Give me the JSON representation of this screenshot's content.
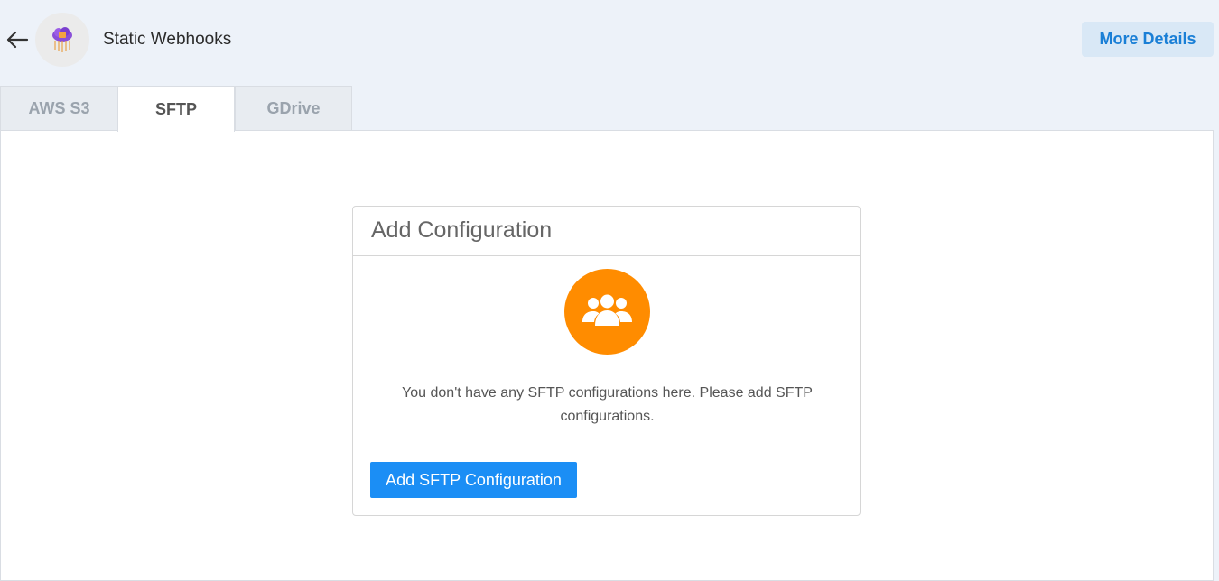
{
  "header": {
    "title": "Static Webhooks",
    "more_details_label": "More Details",
    "back_icon": "arrow-left-icon",
    "logo_icon": "cloud-webhook-logo"
  },
  "tabs": [
    {
      "label": "AWS S3",
      "active": false
    },
    {
      "label": "SFTP",
      "active": true
    },
    {
      "label": "GDrive",
      "active": false
    }
  ],
  "card": {
    "title": "Add Configuration",
    "empty_icon": "users-group-icon",
    "empty_message": "You don't have any SFTP configurations here. Please add SFTP configurations.",
    "add_button_label": "Add SFTP Configuration"
  },
  "colors": {
    "accent_orange": "#ff8c00",
    "primary_blue": "#1b8ef5",
    "link_blue": "#1a7fd6",
    "background": "#edf2f9"
  }
}
